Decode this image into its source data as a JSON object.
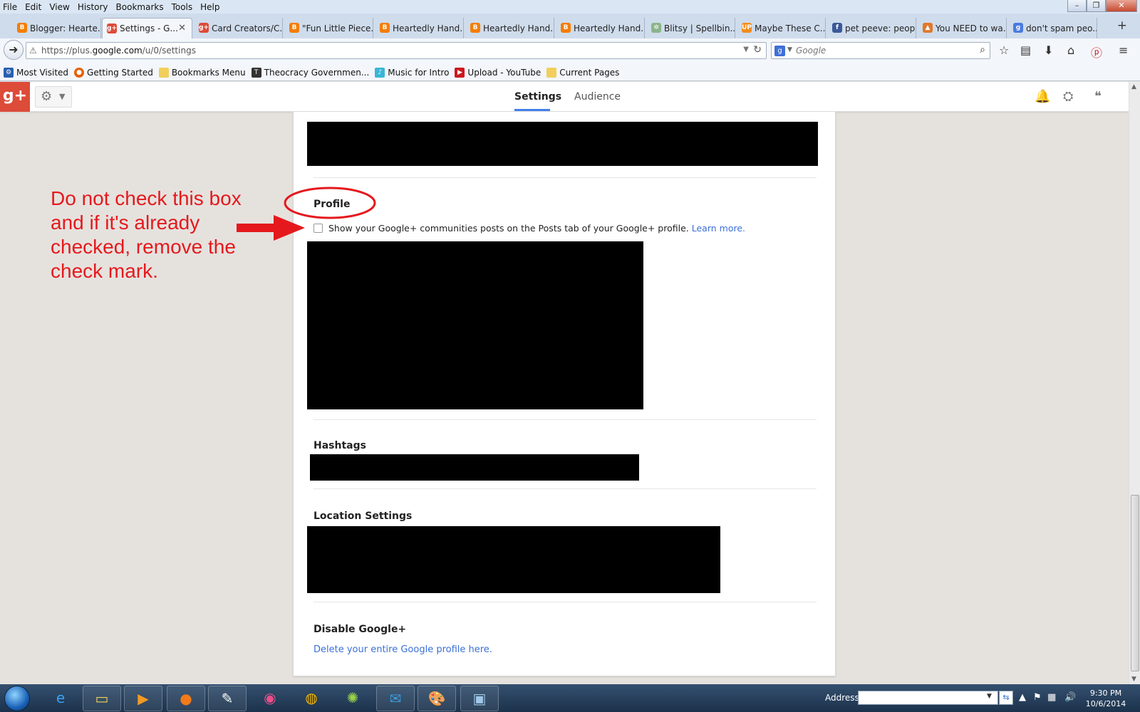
{
  "browser": {
    "menu": [
      "File",
      "Edit",
      "View",
      "History",
      "Bookmarks",
      "Tools",
      "Help"
    ],
    "window_controls": {
      "minimize": "–",
      "restore": "❐",
      "close": "✕"
    },
    "tabs": [
      {
        "title": "Blogger: Hearte...",
        "icon": "blogger-icon",
        "active": false
      },
      {
        "title": "Settings - G...",
        "icon": "google-plus-icon",
        "active": true
      },
      {
        "title": "Card Creators/C...",
        "icon": "google-plus-icon",
        "active": false
      },
      {
        "title": "\"Fun Little Piece...",
        "icon": "blogger-icon",
        "active": false
      },
      {
        "title": "Heartedly Hand...",
        "icon": "blogger-icon",
        "active": false
      },
      {
        "title": "Heartedly Hand...",
        "icon": "blogger-icon",
        "active": false
      },
      {
        "title": "Heartedly Hand...",
        "icon": "blogger-icon",
        "active": false
      },
      {
        "title": "Blitsy | Spellbin...",
        "icon": "blitsy-icon",
        "active": false
      },
      {
        "title": "Maybe These C...",
        "icon": "up-icon",
        "active": false
      },
      {
        "title": "pet peeve: peop...",
        "icon": "facebook-icon",
        "active": false
      },
      {
        "title": "You NEED to wa...",
        "icon": "fox-icon",
        "active": false
      },
      {
        "title": "don't spam peo...",
        "icon": "google-icon",
        "active": false
      }
    ],
    "url": {
      "prefix": "https://plus.",
      "domain": "google.com",
      "path": "/u/0/settings"
    },
    "search_placeholder": "Google",
    "bookmarks": [
      {
        "label": "Most Visited",
        "icon": "gear-bookmark-icon"
      },
      {
        "label": "Getting Started",
        "icon": "firefox-icon"
      },
      {
        "label": "Bookmarks Menu",
        "icon": "folder-icon"
      },
      {
        "label": "Theocracy Governmen...",
        "icon": "t-icon"
      },
      {
        "label": "Music for Intro",
        "icon": "music-icon"
      },
      {
        "label": "Upload - YouTube",
        "icon": "youtube-icon"
      },
      {
        "label": "Current Pages",
        "icon": "folder-icon"
      }
    ]
  },
  "gplus": {
    "logo": "g+",
    "tabs": {
      "settings": "Settings",
      "audience": "Audience"
    }
  },
  "settings": {
    "profile_title": "Profile",
    "profile_checkbox_label": "Show your Google+ communities posts on the Posts tab of your Google+ profile.",
    "profile_checkbox_checked": false,
    "learn_more": "Learn more.",
    "hashtags_title": "Hashtags",
    "location_title": "Location Settings",
    "disable_title": "Disable Google+",
    "delete_link": "Delete your entire Google profile here."
  },
  "annotation": {
    "text": "Do not check this box and if it's already checked, remove the check mark.",
    "color": "#e5191d"
  },
  "taskbar": {
    "address_label": "Address",
    "address_value": "",
    "time": "9:30 PM",
    "date": "10/6/2014"
  },
  "colors": {
    "gplus_red": "#dd4b39",
    "link_blue": "#3a6fd8",
    "tab_underline": "#427fed"
  }
}
